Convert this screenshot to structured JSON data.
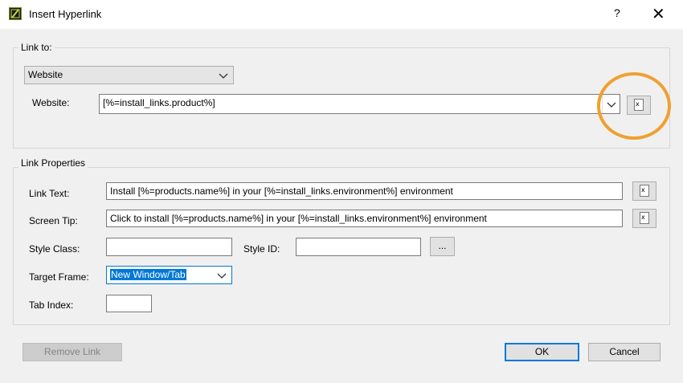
{
  "window": {
    "title": "Insert Hyperlink",
    "help": "?",
    "close": "✕"
  },
  "link_to": {
    "group_label": "Link to:",
    "type_value": "Website",
    "website_label": "Website:",
    "website_value": "[%=install_links.product%]"
  },
  "link_properties": {
    "group_label": "Link Properties",
    "link_text_label": "Link Text:",
    "link_text_value": "Install [%=products.name%] in your [%=install_links.environment%] environment",
    "screen_tip_label": "Screen Tip:",
    "screen_tip_value": "Click to install [%=products.name%] in your [%=install_links.environment%] environment",
    "style_class_label": "Style Class:",
    "style_class_value": "",
    "style_id_label": "Style ID:",
    "style_id_value": "",
    "browse_label": "...",
    "target_frame_label": "Target Frame:",
    "target_frame_value": "New Window/Tab",
    "tab_index_label": "Tab Index:",
    "tab_index_value": ""
  },
  "buttons": {
    "remove_link": "Remove Link",
    "ok": "OK",
    "cancel": "Cancel"
  },
  "icons": {
    "expression": "x",
    "highlight_color": "#f0a030",
    "accent": "#0078d7"
  }
}
